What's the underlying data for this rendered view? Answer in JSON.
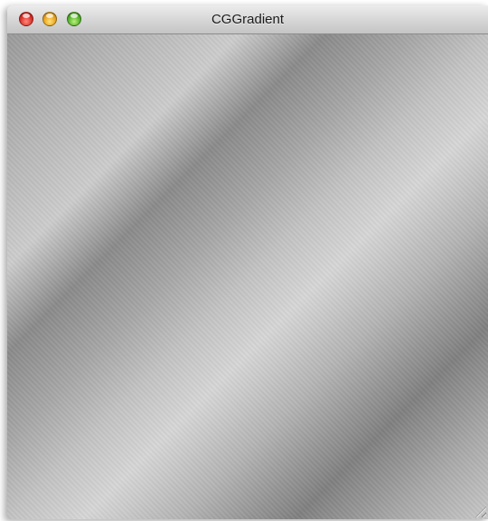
{
  "window": {
    "title": "CGGradient"
  },
  "titlebar": {
    "buttons": [
      {
        "name": "close",
        "color": "#d9302a"
      },
      {
        "name": "minimize",
        "color": "#e8a21c"
      },
      {
        "name": "zoom",
        "color": "#55b02a"
      }
    ]
  },
  "content": {
    "type": "linear-gradient",
    "colors": [
      "#9a9a9a",
      "#cccccc",
      "#8a8a8a",
      "#d6d6d6",
      "#808080",
      "#c8c8c8"
    ]
  }
}
